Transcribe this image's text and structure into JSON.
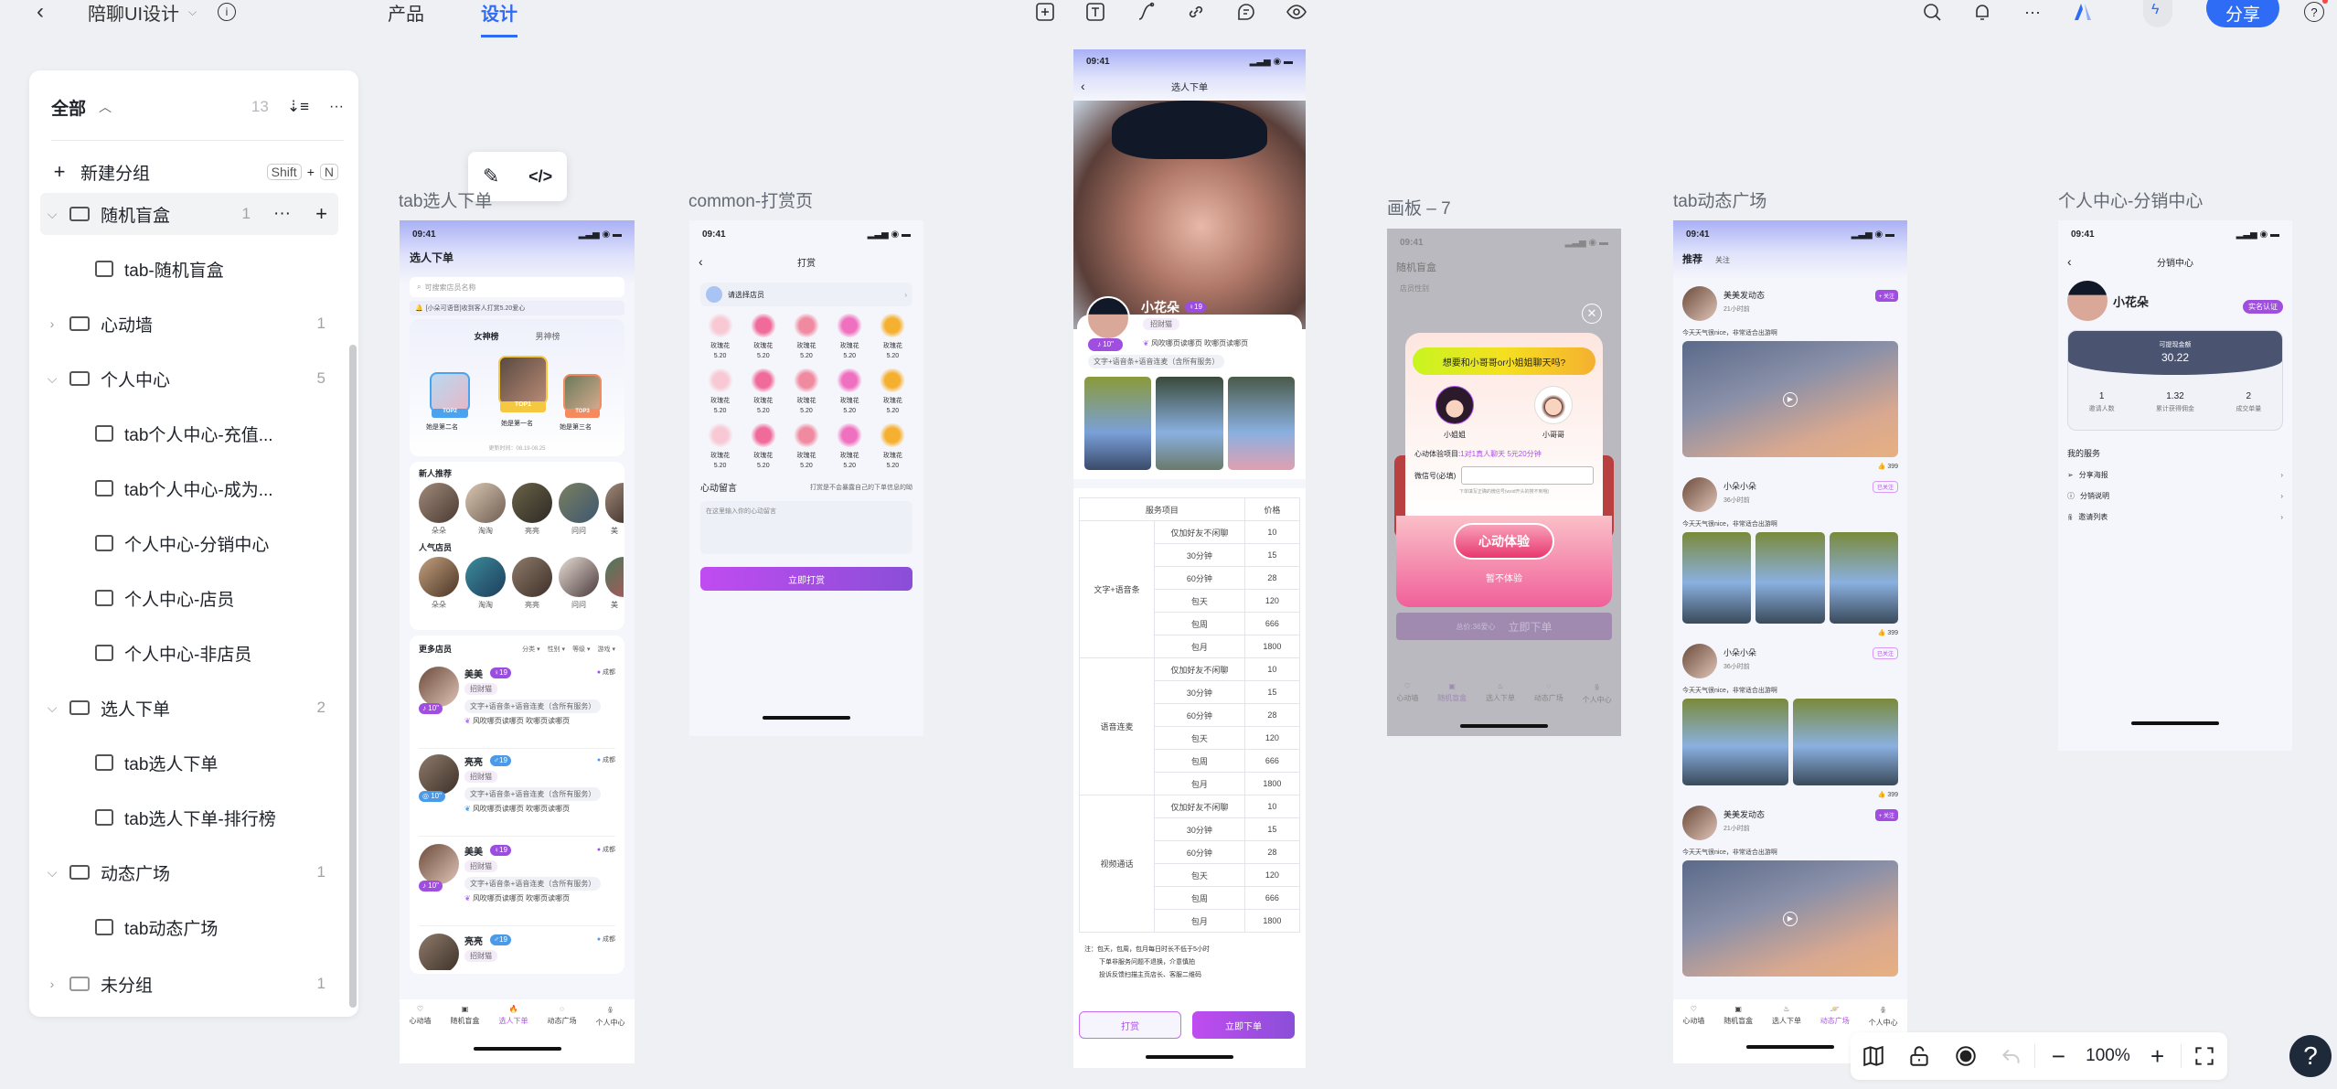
{
  "topbar": {
    "project_name": "陪聊UI设计",
    "tabs": [
      {
        "label": "产品",
        "active": false
      },
      {
        "label": "设计",
        "active": true
      }
    ],
    "share_label": "分享",
    "accent": "#2f6cf6"
  },
  "sidebar": {
    "title": "全部",
    "total_count": "13",
    "new_group": {
      "label": "新建分组",
      "shortcut_key1": "Shift",
      "shortcut_plus": "+",
      "shortcut_key2": "N"
    },
    "groups": [
      {
        "name": "随机盲盒",
        "count": "1",
        "expanded": true,
        "items": [
          "tab-随机盲盒"
        ]
      },
      {
        "name": "心动墙",
        "count": "1",
        "expanded": false,
        "items": []
      },
      {
        "name": "个人中心",
        "count": "5",
        "expanded": true,
        "items": [
          "tab个人中心-充值...",
          "tab个人中心-成为...",
          "个人中心-分销中心",
          "个人中心-店员",
          "个人中心-非店员"
        ]
      },
      {
        "name": "选人下单",
        "count": "2",
        "expanded": true,
        "items": [
          "tab选人下单",
          "tab选人下单-排行榜"
        ]
      },
      {
        "name": "动态广场",
        "count": "1",
        "expanded": true,
        "items": [
          "tab动态广场"
        ]
      },
      {
        "name": "未分组",
        "count": "1",
        "expanded": false,
        "items": []
      }
    ]
  },
  "frames": {
    "f1": {
      "label": "tab选人下单",
      "time": "09:41",
      "title": "选人下单",
      "search_placeholder": "可搜索店员名称",
      "notice": "[小朵可语音]收到客人打赏5.20爱心",
      "rank_tabs": [
        "女神榜",
        "男神榜"
      ],
      "podium": [
        {
          "rank": "TOP2",
          "name": "她是第二名"
        },
        {
          "rank": "TOP1",
          "name": "她是第一名"
        },
        {
          "rank": "TOP3",
          "name": "她是第三名"
        }
      ],
      "update_time": "更新时间：08.19-08.25",
      "new_title": "新人推荐",
      "new_people": [
        "朵朵",
        "淘淘",
        "亮亮",
        "问问",
        "美"
      ],
      "pop_title": "人气店员",
      "pop_people": [
        "朵朵",
        "淘淘",
        "亮亮",
        "问问",
        "美"
      ],
      "more_title": "更多店员",
      "filters": [
        "分类",
        "性别",
        "等级",
        "游戏"
      ],
      "staff": [
        {
          "name": "美美",
          "age": "19",
          "gender": "female",
          "city": "成都",
          "tag": "招财猫",
          "voice": "10\"",
          "services": "文字+语音条+语音连麦（含所有服务）",
          "bio": "风吹哪页读哪页 吹哪页读哪页"
        },
        {
          "name": "亮亮",
          "age": "19",
          "gender": "male",
          "city": "成都",
          "tag": "招财猫",
          "voice": "10\"",
          "services": "文字+语音条+语音连麦（含所有服务）",
          "bio": "风吹哪页读哪页 吹哪页读哪页"
        },
        {
          "name": "美美",
          "age": "19",
          "gender": "female",
          "city": "成都",
          "tag": "招财猫",
          "voice": "10\"",
          "services": "文字+语音条+语音连麦（含所有服务）",
          "bio": "风吹哪页读哪页 吹哪页读哪页"
        },
        {
          "name": "亮亮",
          "age": "19",
          "gender": "male",
          "city": "成都",
          "tag": "招财猫",
          "voice": "",
          "services": "",
          "bio": ""
        }
      ],
      "nav": [
        "心动墙",
        "随机盲盒",
        "选人下单",
        "动态广场",
        "个人中心"
      ],
      "nav_active": 2
    },
    "f2": {
      "label": "common-打赏页",
      "time": "09:41",
      "title": "打赏",
      "select_staff": "请选择店员",
      "gifts": [
        {
          "name": "玫瑰花",
          "price": "5.20"
        },
        {
          "name": "玫瑰花",
          "price": "5.20"
        },
        {
          "name": "玫瑰花",
          "price": "5.20"
        },
        {
          "name": "玫瑰花",
          "price": "5.20"
        },
        {
          "name": "玫瑰花",
          "price": "5.20"
        },
        {
          "name": "玫瑰花",
          "price": "5.20"
        },
        {
          "name": "玫瑰花",
          "price": "5.20"
        },
        {
          "name": "玫瑰花",
          "price": "5.20"
        },
        {
          "name": "玫瑰花",
          "price": "5.20"
        },
        {
          "name": "玫瑰花",
          "price": "5.20"
        },
        {
          "name": "玫瑰花",
          "price": "5.20"
        },
        {
          "name": "玫瑰花",
          "price": "5.20"
        },
        {
          "name": "玫瑰花",
          "price": "5.20"
        },
        {
          "name": "玫瑰花",
          "price": "5.20"
        },
        {
          "name": "玫瑰花",
          "price": "5.20"
        }
      ],
      "message_title": "心动留言",
      "message_hint": "打赏是不会暴露自己的下单信息的呦",
      "message_placeholder": "在这里输入你的心动留言",
      "submit": "立即打赏"
    },
    "f3": {
      "time": "09:41",
      "title": "选人下单",
      "name": "小花朵",
      "age": "19",
      "tag": "招财猫",
      "voice": "10\"",
      "bio": "风吹哪页读哪页 吹哪页读哪页",
      "services": "文字+语音条+语音连麦（含所有服务）",
      "table_headers": [
        "服务项目",
        "价格"
      ],
      "table_groups": [
        {
          "category": "文字+语音条",
          "rows": [
            [
              "仅加好友不闲聊",
              "10"
            ],
            [
              "30分钟",
              "15"
            ],
            [
              "60分钟",
              "28"
            ],
            [
              "包天",
              "120"
            ],
            [
              "包周",
              "666"
            ],
            [
              "包月",
              "1800"
            ]
          ]
        },
        {
          "category": "语音连麦",
          "rows": [
            [
              "仅加好友不闲聊",
              "10"
            ],
            [
              "30分钟",
              "15"
            ],
            [
              "60分钟",
              "28"
            ],
            [
              "包天",
              "120"
            ],
            [
              "包周",
              "666"
            ],
            [
              "包月",
              "1800"
            ]
          ]
        },
        {
          "category": "视频通话",
          "rows": [
            [
              "仅加好友不闲聊",
              "10"
            ],
            [
              "30分钟",
              "15"
            ],
            [
              "60分钟",
              "28"
            ],
            [
              "包天",
              "120"
            ],
            [
              "包周",
              "666"
            ],
            [
              "包月",
              "1800"
            ]
          ]
        }
      ],
      "notes": [
        "注：包天，包周，包月每日时长不低于5小时",
        "下单非服务问题不退换，介意慎拍",
        "投诉反馈扫描主页店长、客服二维码"
      ],
      "tip_btn": "打赏",
      "order_btn": "立即下单"
    },
    "f4": {
      "label": "画板 – 7",
      "time": "09:41",
      "bg_title": "随机盲盒",
      "bg_sub": "店员性别",
      "popup_title": "想要和小哥哥or小姐姐聊天吗?",
      "options": [
        "小姐姐",
        "小哥哥"
      ],
      "exp_label": "心动体验项目:",
      "exp_value": "1对1真人聊天  5元20分钟",
      "wechat_label": "微信号(必填)",
      "wechat_hint": "下单填写正确的微信号(wxid开头的搜不到哦)",
      "confirm": "心动体验",
      "skip": "暂不体验",
      "bg_total": "总价:36爱心",
      "bg_order": "立即下单",
      "nav": [
        "心动墙",
        "随机盲盒",
        "选人下单",
        "动态广场",
        "个人中心"
      ]
    },
    "f5": {
      "label": "tab动态广场",
      "time": "09:41",
      "tabs": [
        "推荐",
        "关注"
      ],
      "posts": [
        {
          "name": "美美发动态",
          "time": "21小时前",
          "follow": "+ 关注",
          "followed": false,
          "text": "今天天气很nice，非常适合出游啊",
          "likes": "399",
          "media": "video"
        },
        {
          "name": "小朵小朵",
          "time": "36小时前",
          "follow": "已关注",
          "followed": true,
          "text": "今天天气很nice，非常适合出游啊",
          "likes": "399",
          "media": "3"
        },
        {
          "name": "小朵小朵",
          "time": "36小时前",
          "follow": "已关注",
          "followed": true,
          "text": "今天天气很nice，非常适合出游啊",
          "likes": "399",
          "media": "2"
        },
        {
          "name": "美美发动态",
          "time": "21小时前",
          "follow": "+ 关注",
          "followed": false,
          "text": "今天天气很nice，非常适合出游啊",
          "likes": "",
          "media": "video"
        }
      ],
      "nav": [
        "心动墙",
        "随机盲盒",
        "选人下单",
        "动态广场",
        "个人中心"
      ],
      "nav_active": 3
    },
    "f6": {
      "label": "个人中心-分销中心",
      "time": "09:41",
      "title": "分销中心",
      "name": "小花朵",
      "verify": "实名认证",
      "balance_label": "可提现金额",
      "balance": "30.22",
      "stats": [
        {
          "value": "1",
          "label": "邀请人数"
        },
        {
          "value": "1.32",
          "label": "累计获得佣金"
        },
        {
          "value": "2",
          "label": "成交单量"
        }
      ],
      "services_title": "我的服务",
      "services": [
        "分享海报",
        "分销说明",
        "邀请列表"
      ]
    }
  },
  "zoombar": {
    "zoom": "100%"
  },
  "help": "?"
}
